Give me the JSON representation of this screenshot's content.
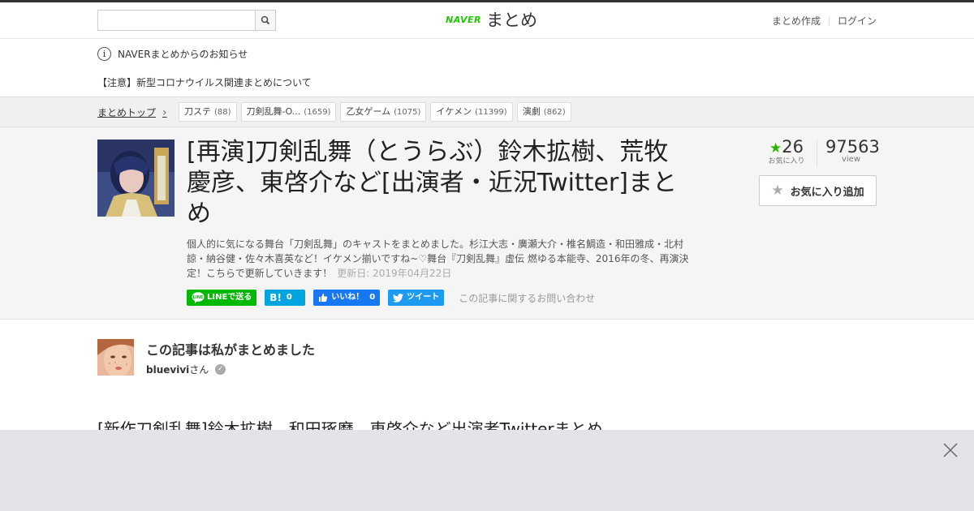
{
  "header": {
    "search_placeholder": "",
    "logo_naver": "NAVER",
    "logo_text": "まとめ",
    "links": [
      "まとめ作成",
      "ログイン"
    ]
  },
  "notice": {
    "title": "NAVERまとめからのお知らせ",
    "link": "【注意】新型コロナウイルス関連まとめについて"
  },
  "breadcrumb": {
    "top": "まとめトップ"
  },
  "tags": [
    {
      "label": "刀ステ",
      "count": "(88)"
    },
    {
      "label": "刀剣乱舞-O...",
      "count": "(1659)"
    },
    {
      "label": "乙女ゲーム",
      "count": "(1075)"
    },
    {
      "label": "イケメン",
      "count": "(11399)"
    },
    {
      "label": "演劇",
      "count": "(862)"
    }
  ],
  "article": {
    "title": "[再演]刀剣乱舞（とうらぶ）鈴木拡樹、荒牧 慶彦、東啓介など[出演者・近況Twitter]まとめ",
    "description": "個人的に気になる舞台「刀剣乱舞」のキャストをまとめました。杉江大志・廣瀬大介・椎名鯛造・和田雅成・北村諒・納谷健・佐々木喜英など！イケメン揃いですね~♡舞台『刀剣乱舞』虚伝 燃ゆる本能寺、2016年の冬、再演決定！こちらで更新していきます！",
    "updated": "更新日: 2019年04月22日",
    "share": {
      "line": "LINEで送る",
      "hatena_count": "0",
      "fb_label": "いいね！",
      "fb_count": "0",
      "tweet": "ツイート"
    },
    "contact": "この記事に関するお問い合わせ",
    "favorites": "26",
    "favorites_label": "お気に入り",
    "views": "97563",
    "views_label": "view",
    "fav_button": "お気に入り追加"
  },
  "author": {
    "by": "この記事は私がまとめました",
    "name": "bluevivi",
    "suffix": "さん"
  },
  "next_heading": "[新作刀剣乱舞]鈴木拡樹、和田琢磨、東啓介など出演者Twitterまとめ",
  "colors": {
    "naver_green": "#1ec800",
    "star_green": "#2db400",
    "line": "#00b900",
    "hatena": "#00a4de",
    "facebook": "#1877f2",
    "twitter": "#1d9bf0"
  }
}
